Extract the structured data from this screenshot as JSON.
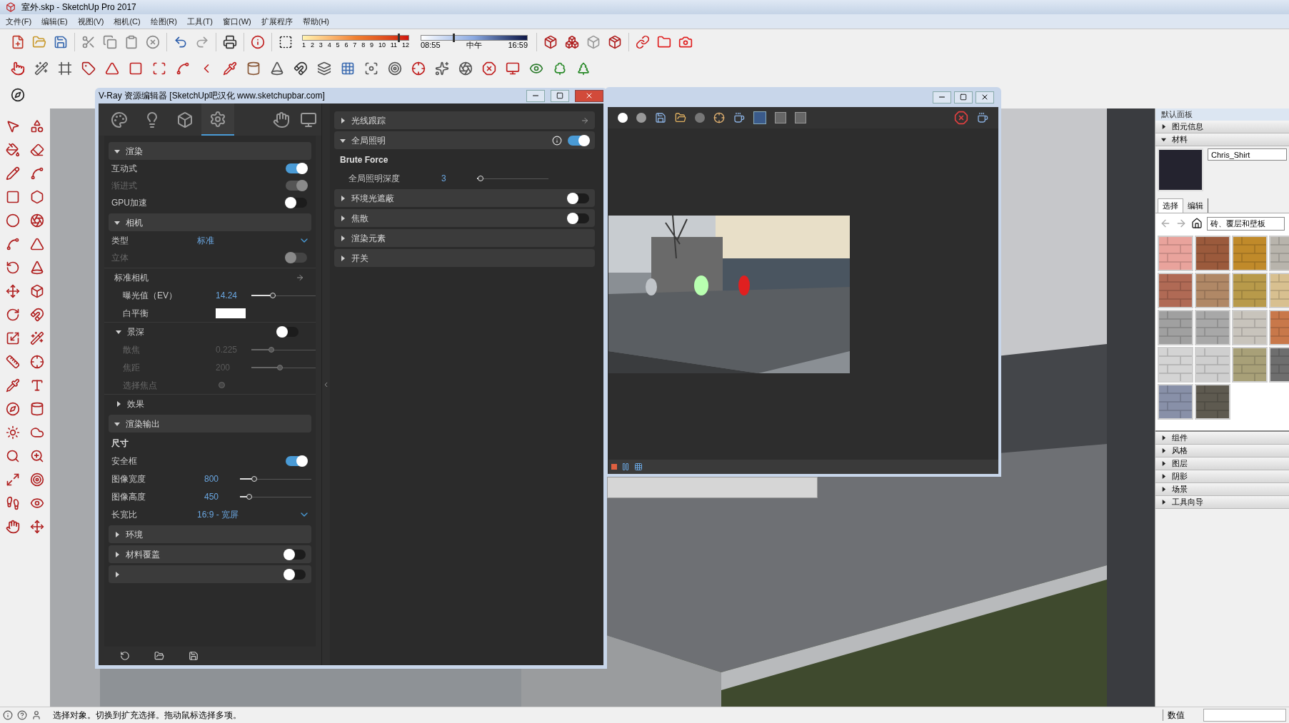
{
  "window": {
    "title": "室外.skp - SketchUp Pro 2017"
  },
  "menu": [
    "文件(F)",
    "编辑(E)",
    "视图(V)",
    "相机(C)",
    "绘图(R)",
    "工具(T)",
    "窗口(W)",
    "扩展程序",
    "帮助(H)"
  ],
  "shadow_toolbar": {
    "month": {
      "labels": [
        "1",
        "2",
        "3",
        "4",
        "5",
        "6",
        "7",
        "8",
        "9",
        "10",
        "11",
        "12"
      ],
      "level": 0.9
    },
    "time": {
      "labels": [
        "08:55",
        "中午",
        "16:59"
      ],
      "level": 0.3
    }
  },
  "vray_editor": {
    "title": "V-Ray 资源编辑器 [SketchUp吧汉化 www.sketchupbar.com]",
    "tabs": [
      {
        "kind": "materials",
        "selected": false
      },
      {
        "kind": "lights",
        "selected": false
      },
      {
        "kind": "geometry",
        "selected": false
      },
      {
        "kind": "settings",
        "selected": true
      }
    ],
    "settings": [
      {
        "kind": "section",
        "label": "渲染",
        "expanded": true,
        "children": [
          {
            "kind": "toggle",
            "label": "互动式",
            "on": true,
            "disabled": false
          },
          {
            "kind": "toggle",
            "label": "渐进式",
            "on": true,
            "disabled": true
          },
          {
            "kind": "toggle",
            "label": "GPU加速",
            "on": false,
            "disabled": false
          }
        ]
      },
      {
        "kind": "section",
        "label": "相机",
        "expanded": true,
        "children": [
          {
            "kind": "dropdown",
            "label": "类型",
            "value": "标准"
          },
          {
            "kind": "toggle",
            "label": "立体",
            "on": false,
            "disabled": true
          },
          {
            "kind": "subheader",
            "label": "标准相机",
            "children": [
              {
                "kind": "slider",
                "label": "曝光值（EV）",
                "value": "14.24",
                "level": 0.3,
                "disabled": false
              },
              {
                "kind": "color",
                "label": "白平衡",
                "color": "#ffffff"
              },
              {
                "kind": "group",
                "label": "景深",
                "expanded": true,
                "on": false,
                "children": [
                  {
                    "kind": "slider",
                    "label": "散焦",
                    "value": "0.225",
                    "level": 0.28,
                    "disabled": true
                  },
                  {
                    "kind": "slider",
                    "label": "焦距",
                    "value": "200",
                    "level": 0.4,
                    "disabled": true
                  },
                  {
                    "kind": "pick",
                    "label": "选择焦点",
                    "disabled": true
                  }
                ]
              },
              {
                "kind": "group",
                "label": "效果",
                "expanded": false
              }
            ]
          }
        ]
      },
      {
        "kind": "section",
        "label": "渲染输出",
        "expanded": true,
        "children": [
          {
            "kind": "label",
            "label": "尺寸"
          },
          {
            "kind": "toggle",
            "label": "安全框",
            "on": true,
            "disabled": false
          },
          {
            "kind": "slider",
            "label": "图像宽度",
            "value": "800",
            "level": 0.2,
            "disabled": false
          },
          {
            "kind": "slider",
            "label": "图像高度",
            "value": "450",
            "level": 0.13,
            "disabled": false
          },
          {
            "kind": "dropdown",
            "label": "长宽比",
            "value": "16:9 - 宽屏"
          }
        ]
      },
      {
        "kind": "section",
        "label": "环境",
        "expanded": false
      },
      {
        "kind": "section",
        "label": "材料覆盖",
        "expanded": false,
        "on": false
      },
      {
        "kind": "section",
        "expanded": false,
        "on": false
      }
    ],
    "render_settings": [
      {
        "kind": "pinned_section",
        "label": "光线跟踪",
        "expanded": false
      },
      {
        "kind": "section",
        "label": "全局照明",
        "expanded": true,
        "info": true,
        "on": true,
        "children": [
          {
            "kind": "label",
            "label": "Brute Force"
          },
          {
            "kind": "slider",
            "label": "全局照明深度",
            "value": "3",
            "level": 0.05,
            "disabled": false
          }
        ]
      },
      {
        "kind": "section",
        "label": "环境光遮蔽",
        "expanded": false,
        "on": false
      },
      {
        "kind": "section",
        "label": "焦散",
        "expanded": false,
        "on": false
      },
      {
        "kind": "section",
        "label": "渲染元素",
        "expanded": false
      },
      {
        "kind": "section",
        "label": "开关",
        "expanded": false
      }
    ]
  },
  "tray": {
    "title": "默认面板",
    "panels_top": [
      {
        "label": "图元信息",
        "expanded": false
      },
      {
        "label": "材料",
        "expanded": true
      }
    ],
    "material_name": "Chris_Shirt",
    "tabs": [
      {
        "label": "选择",
        "selected": true
      },
      {
        "label": "编辑",
        "selected": false
      }
    ],
    "library": "砖、覆层和壁板",
    "materials": [
      {
        "color": "#e9a39c"
      },
      {
        "color": "#9b5a3c"
      },
      {
        "color": "#c08a2a"
      },
      {
        "color": "#b8b4ac"
      },
      {
        "color": "#b06a55"
      },
      {
        "color": "#b08866"
      },
      {
        "color": "#b89a4a"
      },
      {
        "color": "#d8c090"
      },
      {
        "color": "#a0a0a0"
      },
      {
        "color": "#a8a8a8"
      },
      {
        "color": "#c8c4bc"
      },
      {
        "color": "#c8784a"
      },
      {
        "color": "#d4d4d4"
      },
      {
        "color": "#cfcfcf"
      },
      {
        "color": "#a8a078"
      },
      {
        "color": "#6e6e6e"
      },
      {
        "color": "#8890a8"
      },
      {
        "color": "#5e5a50"
      }
    ],
    "panels_bottom": [
      {
        "label": "组件",
        "expanded": false
      },
      {
        "label": "风格",
        "expanded": false
      },
      {
        "label": "图层",
        "expanded": false
      },
      {
        "label": "阴影",
        "expanded": false
      },
      {
        "label": "场景",
        "expanded": false
      },
      {
        "label": "工具向导",
        "expanded": false
      }
    ]
  },
  "status_bar": {
    "message": "选择对象。切换到扩充选择。拖动鼠标选择多项。",
    "measurements_label": "数值"
  }
}
